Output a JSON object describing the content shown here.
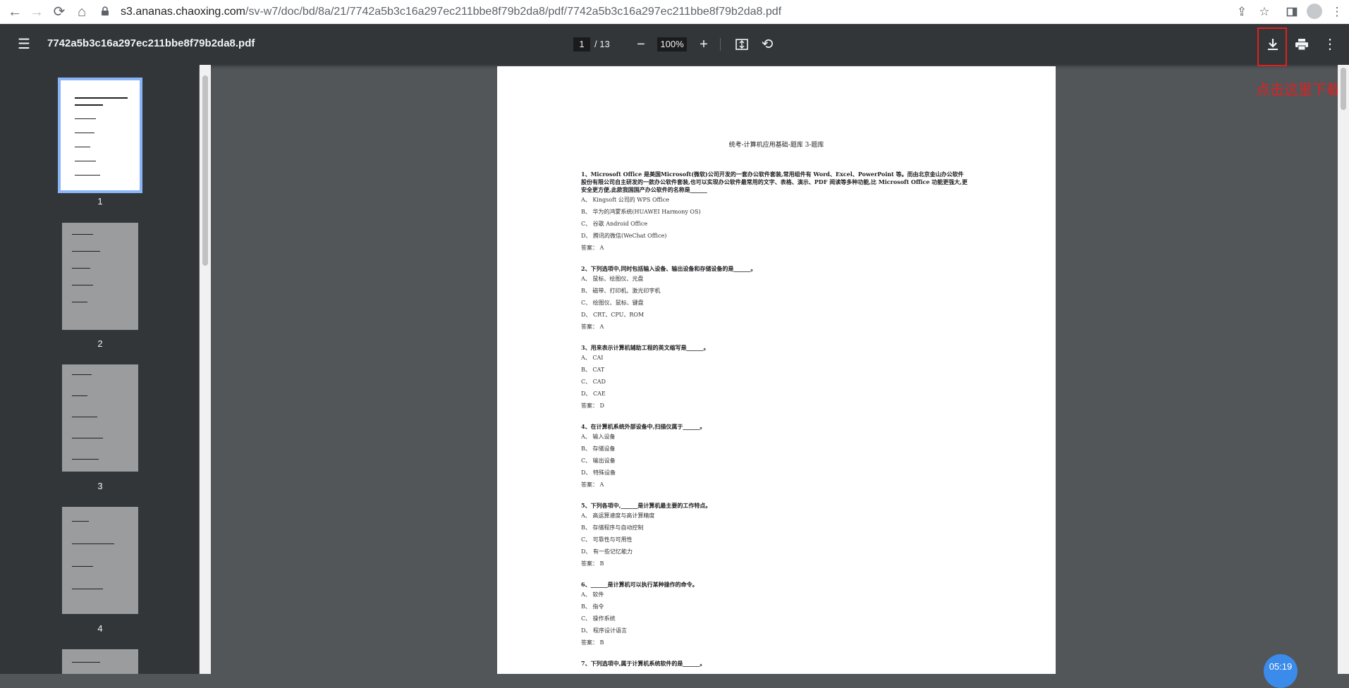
{
  "browser": {
    "url_host": "s3.ananas.chaoxing.com",
    "url_path": "/sv-w7/doc/bd/8a/21/7742a5b3c16a297ec211bbe8f79b2da8/pdf/7742a5b3c16a297ec211bbe8f79b2da8.pdf"
  },
  "toolbar": {
    "title": "7742a5b3c16a297ec211bbe8f79b2da8.pdf",
    "current_page": "1",
    "page_total": "/ 13",
    "zoom": "100%"
  },
  "annotation": "点击这里下载",
  "sidebar": {
    "thumbnails": [
      {
        "label": "1"
      },
      {
        "label": "2"
      },
      {
        "label": "3"
      },
      {
        "label": "4"
      }
    ]
  },
  "document": {
    "title": "统考-计算机应用基础-题库 3-题库",
    "questions": [
      {
        "text": "1、Microsoft Office 是美国Microsoft(微软)公司开发的一套办公软件套装,常用组件有 Word、Excel、PowerPoint 等。而由北京金山办公软件股份有限公司自主研发的一款办公软件套装,也可以实现办公软件最常用的文字、表格、演示、PDF 阅读等多种功能,比 Microsoft Office 功能更强大,更安全更方便,此款我国国产办公软件的名称是______",
        "options": [
          "A、 Kingsoft 公司的 WPS Office",
          "B、 华为的鸿蒙系统(HUAWEI Harmony OS)",
          "C、 谷歌 Android Office",
          "D、 腾讯的微信(WeChat Office)"
        ],
        "answer": "答案： A"
      },
      {
        "text": "2、下列选项中,同时包括输入设备、输出设备和存储设备的是______。",
        "options": [
          "A、 鼠标、绘图仪、光盘",
          "B、 磁带、打印机、激光印字机",
          "C、 绘图仪、鼠标、键盘",
          "D、 CRT、CPU、ROM"
        ],
        "answer": "答案： A"
      },
      {
        "text": "3、用来表示计算机辅助工程的英文缩写是______。",
        "options": [
          "A、 CAI",
          "B、 CAT",
          "C、 CAD",
          "D、 CAE"
        ],
        "answer": "答案： D"
      },
      {
        "text": "4、在计算机系统外部设备中,扫描仪属于______。",
        "options": [
          "A、 输入设备",
          "B、 存储设备",
          "C、 输出设备",
          "D、 特殊设备"
        ],
        "answer": "答案： A"
      },
      {
        "text": "5、下列各项中,______是计算机最主要的工作特点。",
        "options": [
          "A、 高运算速度与高计算精度",
          "B、 存储程序与自动控制",
          "C、 可靠性与可用性",
          "D、 有一些记忆能力"
        ],
        "answer": "答案： B"
      },
      {
        "text": "6、______是计算机可以执行某种操作的命令。",
        "options": [
          "A、 软件",
          "B、 指令",
          "C、 操作系统",
          "D、 程序设计语言"
        ],
        "answer": "答案： B"
      },
      {
        "text": "7、下列选项中,属于计算机系统软件的是______。",
        "options": [],
        "answer": ""
      }
    ]
  },
  "timer": "05:19"
}
